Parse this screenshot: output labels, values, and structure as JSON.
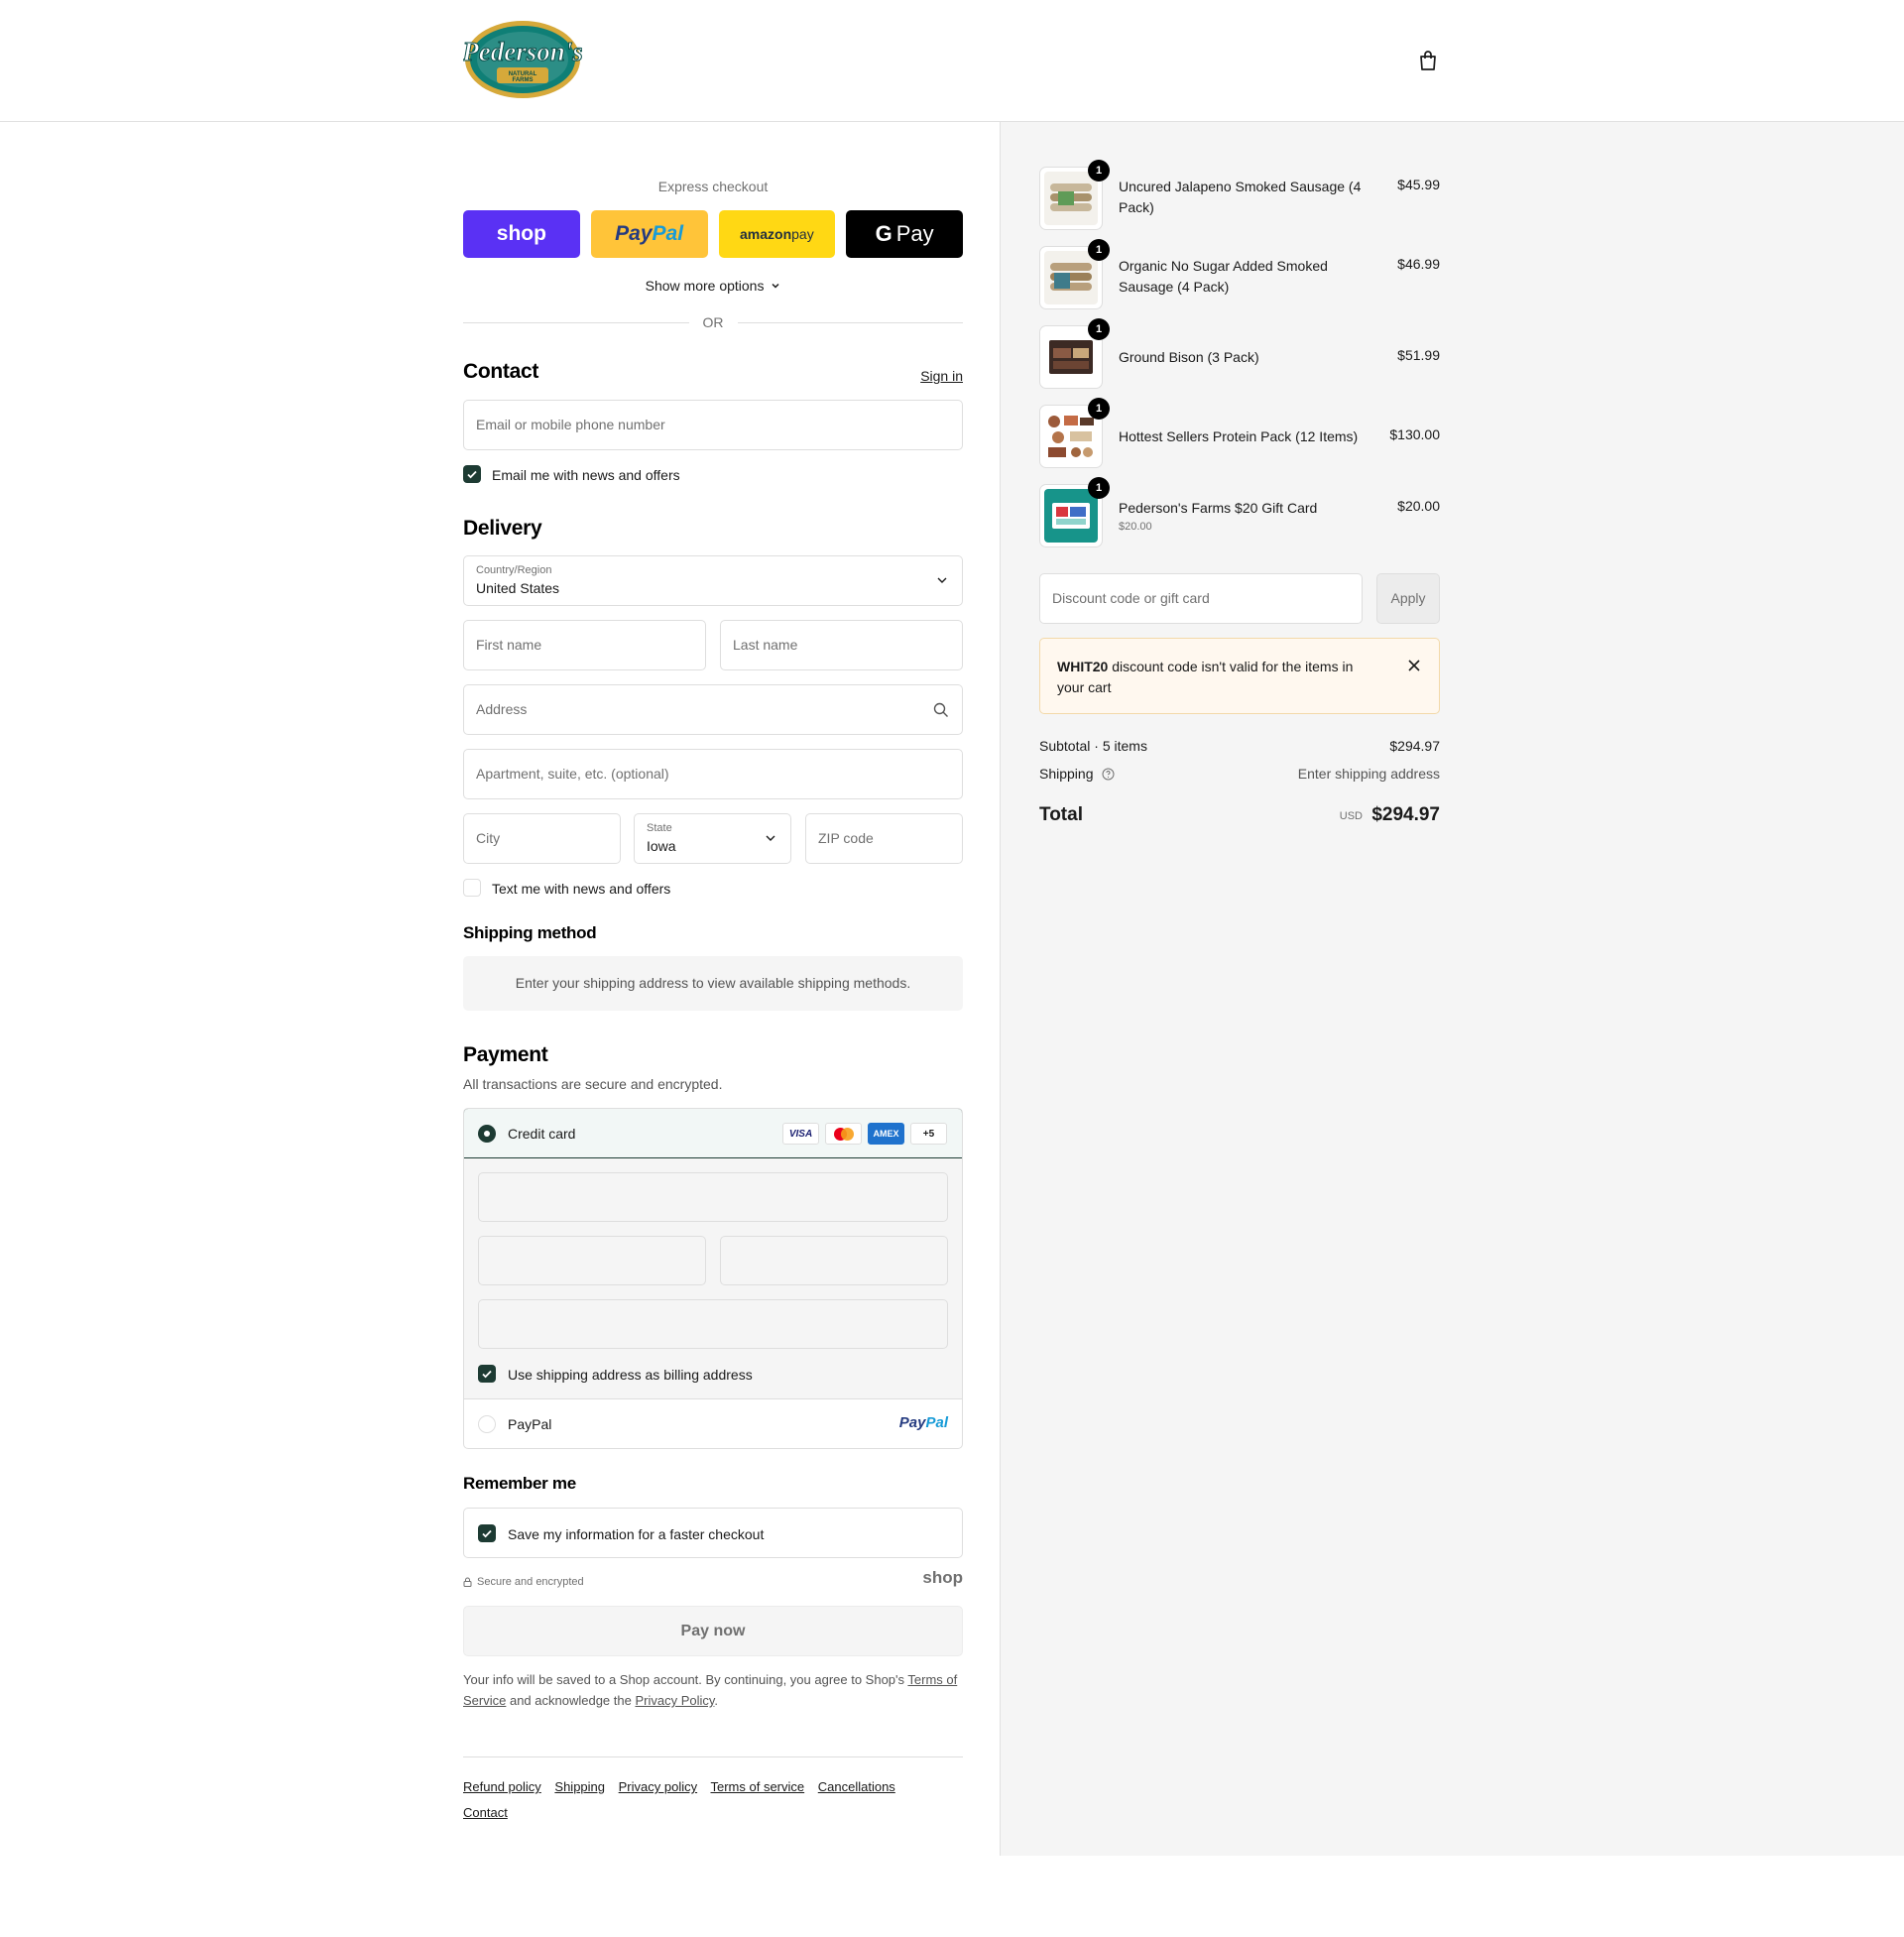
{
  "header": {
    "logo_text": "Pederson's",
    "logo_sub": "NATURAL FARMS"
  },
  "express": {
    "title": "Express checkout",
    "shop_label": "shop",
    "paypal_label_1": "Pay",
    "paypal_label_2": "Pal",
    "amazon_label_1": "amazon",
    "amazon_label_2": " pay",
    "gpay_label_g": "G",
    "gpay_label": "Pay",
    "more_options": "Show more options",
    "or": "OR"
  },
  "contact": {
    "title": "Contact",
    "sign_in": "Sign in",
    "email_placeholder": "Email or mobile phone number",
    "email_news": "Email me with news and offers"
  },
  "delivery": {
    "title": "Delivery",
    "country_label": "Country/Region",
    "country_value": "United States",
    "first_name": "First name",
    "last_name": "Last name",
    "address": "Address",
    "apartment": "Apartment, suite, etc. (optional)",
    "city": "City",
    "state_label": "State",
    "state_value": "Iowa",
    "zip": "ZIP code",
    "text_news": "Text me with news and offers"
  },
  "shipping_method": {
    "title": "Shipping method",
    "message": "Enter your shipping address to view available shipping methods."
  },
  "payment": {
    "title": "Payment",
    "subtitle": "All transactions are secure and encrypted.",
    "credit_card": "Credit card",
    "brands": [
      "VISA",
      "",
      "AMEX",
      "+5"
    ],
    "billing_same": "Use shipping address as billing address",
    "paypal": "PayPal",
    "paypal_logo_1": "Pay",
    "paypal_logo_2": "Pal"
  },
  "remember": {
    "title": "Remember me",
    "save_info": "Save my information for a faster checkout",
    "secure": "Secure and encrypted",
    "shop_mark": "shop"
  },
  "pay_now": "Pay now",
  "consent": {
    "text_1": "Your info will be saved to a Shop account. By continuing, you agree to Shop's ",
    "terms": "Terms of Service",
    "text_2": " and acknowledge the ",
    "privacy": "Privacy Policy",
    "text_3": "."
  },
  "footer": {
    "links": [
      "Refund policy",
      "Shipping",
      "Privacy policy",
      "Terms of service",
      "Cancellations",
      "Contact"
    ]
  },
  "order": {
    "items": [
      {
        "name": "Uncured Jalapeno Smoked Sausage (4 Pack)",
        "price": "$45.99",
        "qty": "1",
        "sub": ""
      },
      {
        "name": "Organic No Sugar Added Smoked Sausage (4 Pack)",
        "price": "$46.99",
        "qty": "1",
        "sub": ""
      },
      {
        "name": "Ground Bison (3 Pack)",
        "price": "$51.99",
        "qty": "1",
        "sub": ""
      },
      {
        "name": "Hottest Sellers Protein Pack (12 Items)",
        "price": "$130.00",
        "qty": "1",
        "sub": ""
      },
      {
        "name": "Pederson's Farms $20 Gift Card",
        "price": "$20.00",
        "qty": "1",
        "sub": "$20.00"
      }
    ],
    "discount_placeholder": "Discount code or gift card",
    "apply": "Apply",
    "alert_code": "WHIT20",
    "alert_text": " discount code isn't valid for the items in your cart",
    "subtotal_label": "Subtotal · 5 items",
    "subtotal_value": "$294.97",
    "shipping_label": "Shipping",
    "shipping_value": "Enter shipping address",
    "total_label": "Total",
    "currency": "USD",
    "total_value": "$294.97"
  },
  "colors": {
    "accent": "#1d3b33",
    "shop_purple": "#5a31f4",
    "paypal_yellow": "#ffc439",
    "amazon_yellow": "#ffd814"
  }
}
